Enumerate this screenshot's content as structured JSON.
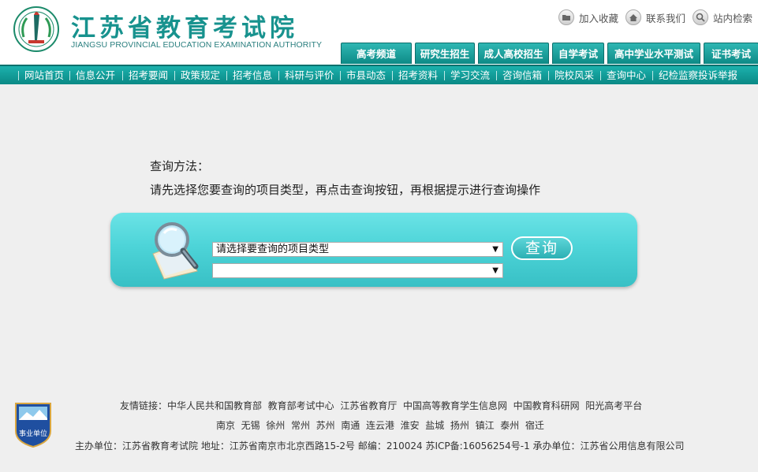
{
  "site": {
    "title_cn": "江苏省教育考试院",
    "title_en": "JIANGSU PROVINCIAL EDUCATION EXAMINATION AUTHORITY"
  },
  "utility_links": [
    "加入收藏",
    "联系我们",
    "站内检索"
  ],
  "channel_tabs": [
    "高考频道",
    "研究生招生",
    "成人高校招生",
    "自学考试",
    "高中学业水平测试",
    "证书考试"
  ],
  "nav_items": [
    "网站首页",
    "信息公开",
    "招考要闻",
    "政策规定",
    "招考信息",
    "科研与评价",
    "市县动态",
    "招考资料",
    "学习交流",
    "咨询信箱",
    "院校风采",
    "查询中心",
    "纪检监察投诉举报"
  ],
  "query": {
    "method_title": "查询方法：",
    "method_desc": "请先选择您要查询的项目类型，再点击查询按钮，再根据提示进行查询操作",
    "select_type_value": "请选择要查询的项目类型",
    "select_sub_value": "",
    "button_label": "查询"
  },
  "footer": {
    "links_label": "友情链接：",
    "links": [
      "中华人民共和国教育部",
      "教育部考试中心",
      "江苏省教育厅",
      "中国高等教育学生信息网",
      "中国教育科研网",
      "阳光高考平台"
    ],
    "cities": [
      "南京",
      "无锡",
      "徐州",
      "常州",
      "苏州",
      "南通",
      "连云港",
      "淮安",
      "盐城",
      "扬州",
      "镇江",
      "泰州",
      "宿迁"
    ],
    "sponsor": "主办单位：江苏省教育考试院   地址：江苏省南京市北京西路15-2号   邮编：210024   苏ICP备:16056254号-1   承办单位：江苏省公用信息有限公司",
    "badge_text": "事业单位"
  },
  "colors": {
    "accent": "#0f8d89",
    "panel": "#4dd4d8",
    "background": "#efefef"
  }
}
